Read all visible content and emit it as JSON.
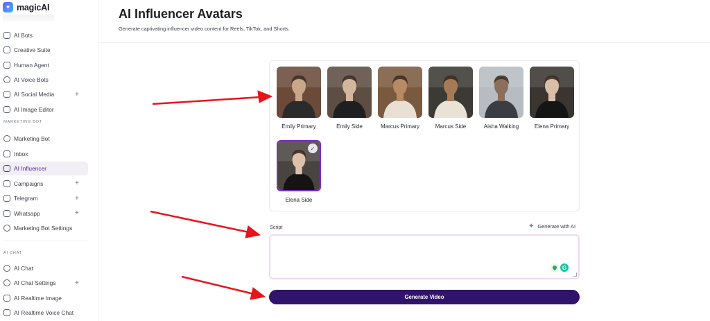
{
  "app": {
    "name": "magicAI"
  },
  "sidebar": {
    "items_top": [
      {
        "label": "AI Bots",
        "icon": "bot-icon"
      },
      {
        "label": "Creative Suite",
        "icon": "palette-icon"
      },
      {
        "label": "Human Agent",
        "icon": "agent-icon"
      },
      {
        "label": "AI Voice Bots",
        "icon": "voice-icon"
      },
      {
        "label": "AI Social Media",
        "icon": "social-icon",
        "expandable": true
      },
      {
        "label": "AI Image Editor",
        "icon": "image-icon"
      }
    ],
    "section_marketing": "MARKETING BOT",
    "items_marketing": [
      {
        "label": "Marketing Bot",
        "icon": "target-icon"
      },
      {
        "label": "Inbox",
        "icon": "inbox-icon"
      },
      {
        "label": "AI Influencer",
        "icon": "wave-icon",
        "active": true
      },
      {
        "label": "Campaigns",
        "icon": "flag-icon",
        "expandable": true
      },
      {
        "label": "Telegram",
        "icon": "send-icon",
        "expandable": true
      },
      {
        "label": "Whatsapp",
        "icon": "whatsapp-icon",
        "expandable": true
      },
      {
        "label": "Marketing Bot Settings",
        "icon": "settings-icon"
      }
    ],
    "section_chat": "AI CHAT",
    "items_chat": [
      {
        "label": "AI Chat",
        "icon": "chat-icon"
      },
      {
        "label": "AI Chat Settings",
        "icon": "settings-icon",
        "expandable": true
      },
      {
        "label": "AI Realtime Image",
        "icon": "image-icon"
      },
      {
        "label": "AI Realtime Voice Chat",
        "icon": "wave-icon"
      }
    ],
    "expand_symbol": "+"
  },
  "main": {
    "title": "AI Influencer Avatars",
    "subtitle": "Generate captivating influencer video content for Reels, TikTok, and Shorts.",
    "avatars": [
      {
        "name": "Emily Primary",
        "selected": false,
        "palette": [
          "#6b4a3a",
          "#c9a68a",
          "#2b2b2b"
        ]
      },
      {
        "name": "Emily Side",
        "selected": false,
        "palette": [
          "#5e4d42",
          "#d2b79e",
          "#1f1f22"
        ]
      },
      {
        "name": "Marcus Primary",
        "selected": false,
        "palette": [
          "#7a5a3e",
          "#b88a63",
          "#e8e0d3"
        ]
      },
      {
        "name": "Marcus Side",
        "selected": false,
        "palette": [
          "#3c3a34",
          "#a57a55",
          "#e9e3d6"
        ]
      },
      {
        "name": "Aisha Walking",
        "selected": false,
        "palette": [
          "#b7bcc2",
          "#8a6f5c",
          "#3a3d42"
        ]
      },
      {
        "name": "Elena Primary",
        "selected": false,
        "palette": [
          "#3a3530",
          "#d9bfa8",
          "#151515"
        ]
      },
      {
        "name": "Elena Side",
        "selected": true,
        "palette": [
          "#4a4440",
          "#dcc2ab",
          "#141414"
        ]
      }
    ],
    "selected_check": "✓",
    "script": {
      "label": "Script",
      "value": "",
      "generate_ai_label": "Generate with AI",
      "grammarly_letter": "G"
    },
    "generate_button": "Generate Video"
  },
  "colors": {
    "accent": "#32136b",
    "active_bg": "#f1eef6",
    "arrow": "#e8141b",
    "selected_border": "#7a2ec8"
  }
}
